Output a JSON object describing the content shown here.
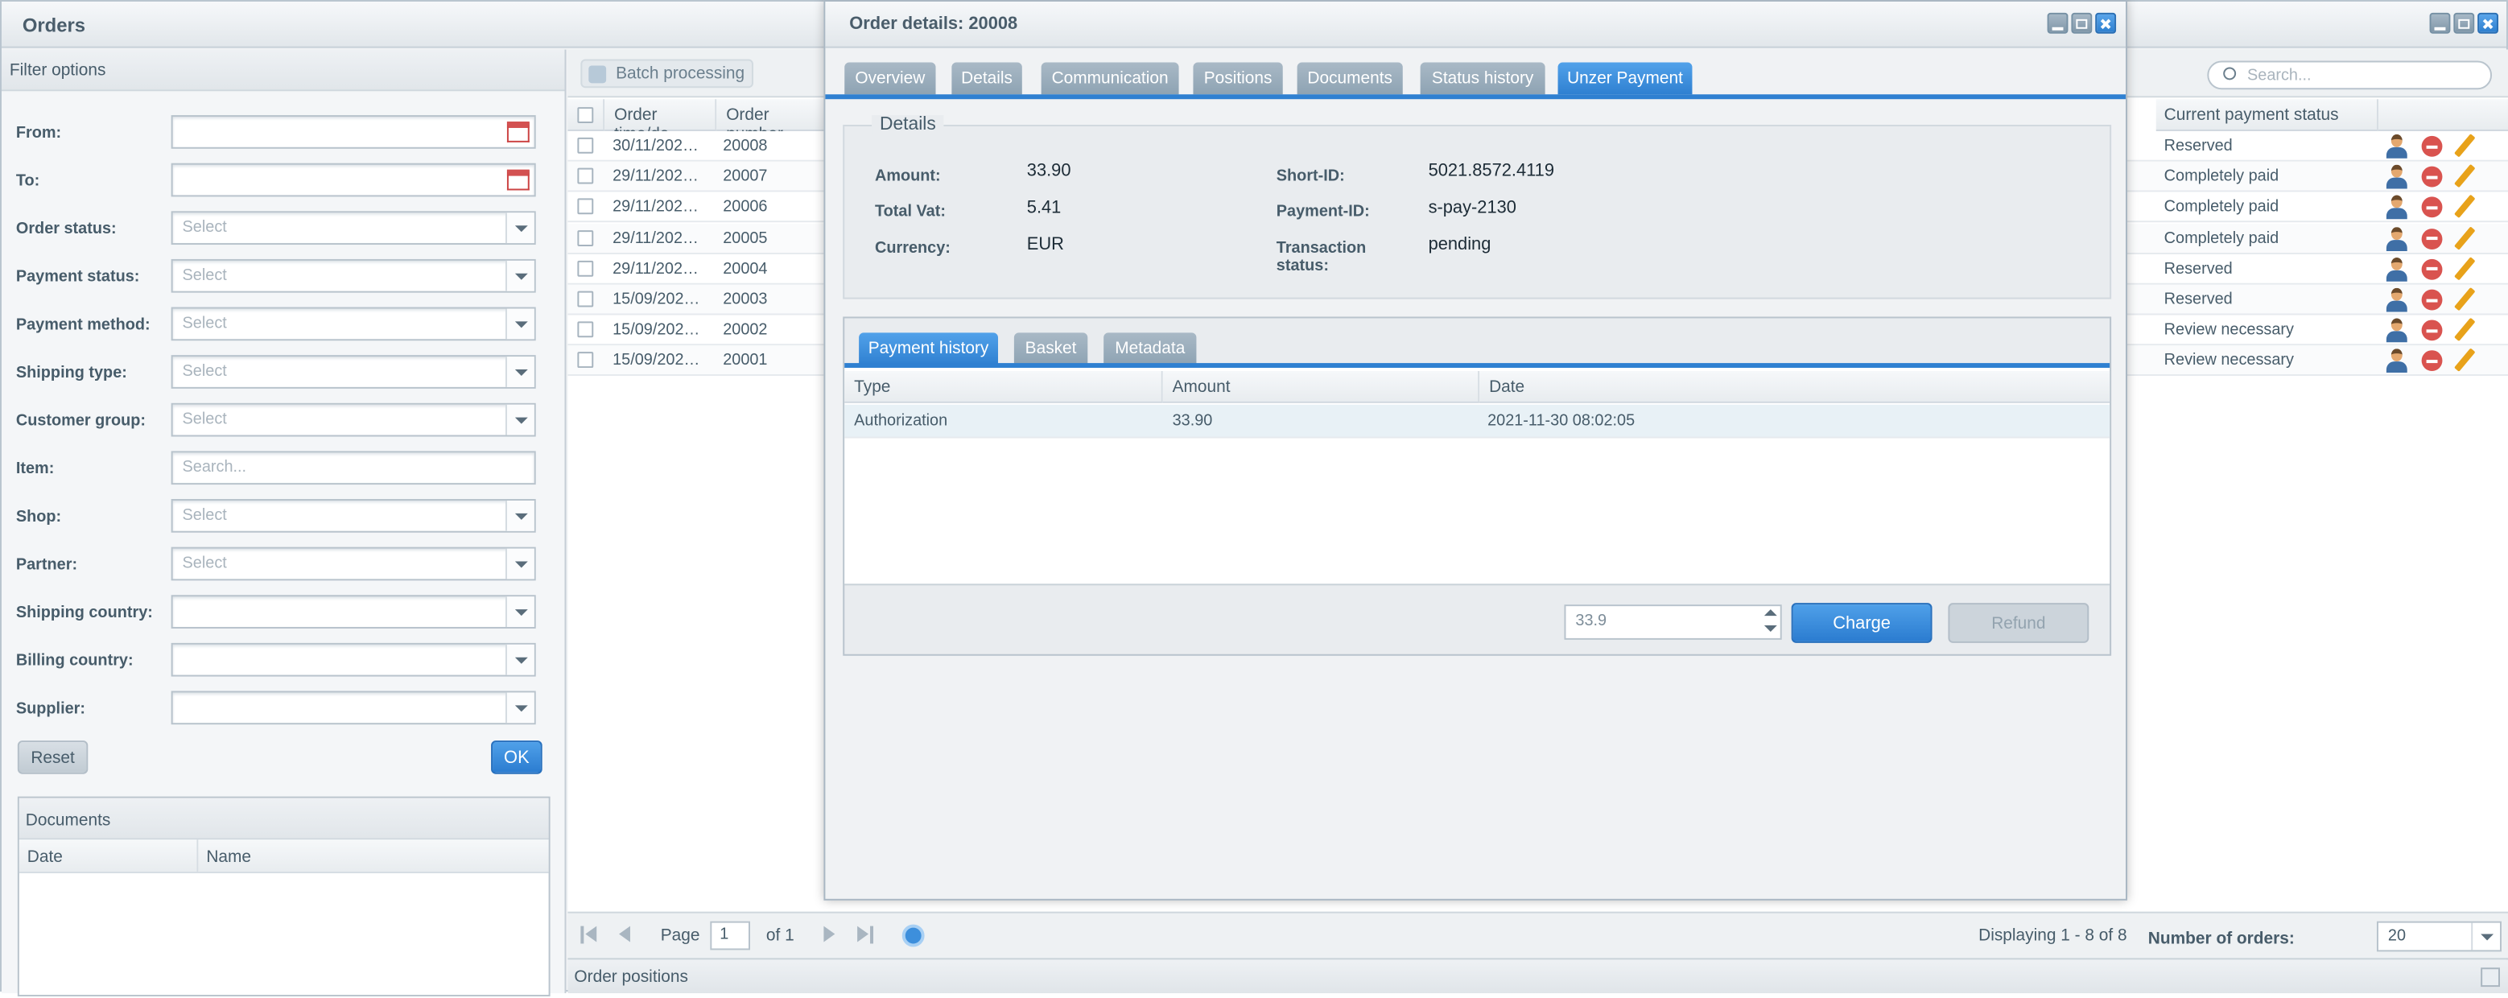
{
  "window": {
    "title": "Orders"
  },
  "filter": {
    "header": "Filter options",
    "fields": [
      {
        "label": "From:",
        "value": "",
        "kind": "date"
      },
      {
        "label": "To:",
        "value": "",
        "kind": "date"
      },
      {
        "label": "Order status:",
        "placeholder": "Select",
        "kind": "select"
      },
      {
        "label": "Payment status:",
        "placeholder": "Select",
        "kind": "select"
      },
      {
        "label": "Payment method:",
        "placeholder": "Select",
        "kind": "select"
      },
      {
        "label": "Shipping type:",
        "placeholder": "Select",
        "kind": "select"
      },
      {
        "label": "Customer group:",
        "placeholder": "Select",
        "kind": "select"
      },
      {
        "label": "Item:",
        "placeholder": "Search...",
        "kind": "text"
      },
      {
        "label": "Shop:",
        "placeholder": "Select",
        "kind": "select"
      },
      {
        "label": "Partner:",
        "placeholder": "Select",
        "kind": "select"
      },
      {
        "label": "Shipping country:",
        "placeholder": "",
        "kind": "select"
      },
      {
        "label": "Billing country:",
        "placeholder": "",
        "kind": "select"
      },
      {
        "label": "Supplier:",
        "placeholder": "",
        "kind": "select"
      }
    ],
    "reset_label": "Reset",
    "ok_label": "OK",
    "documents": {
      "header": "Documents",
      "columns": [
        "Date",
        "Name"
      ]
    }
  },
  "toolbar": {
    "batch_label": "Batch processing",
    "search_placeholder": "Search..."
  },
  "grid": {
    "columns": [
      "Order time/da",
      "Order number",
      "Current payment status"
    ],
    "rows": [
      {
        "time": "30/11/202…",
        "number": "20008",
        "status": "Reserved"
      },
      {
        "time": "29/11/202…",
        "number": "20007",
        "status": "Completely paid"
      },
      {
        "time": "29/11/202…",
        "number": "20006",
        "status": "Completely paid"
      },
      {
        "time": "29/11/202…",
        "number": "20005",
        "status": "Completely paid"
      },
      {
        "time": "29/11/202…",
        "number": "20004",
        "status": "Reserved"
      },
      {
        "time": "15/09/202…",
        "number": "20003",
        "status": "Reserved"
      },
      {
        "time": "15/09/202…",
        "number": "20002",
        "status": "Review necessary"
      },
      {
        "time": "15/09/202…",
        "number": "20001",
        "status": "Review necessary"
      }
    ]
  },
  "pager": {
    "page_label": "Page",
    "page_value": "1",
    "of_label": "of 1",
    "displaying": "Displaying 1 - 8 of 8",
    "count_label": "Number of orders:",
    "count_value": "20"
  },
  "positions_bar": {
    "label": "Order positions"
  },
  "modal": {
    "title": "Order details: 20008",
    "tabs": [
      "Overview",
      "Details",
      "Communication",
      "Positions",
      "Documents",
      "Status history",
      "Unzer Payment"
    ],
    "active_tab": "Unzer Payment",
    "details": {
      "legend": "Details",
      "amount_label": "Amount:",
      "amount": "33.90",
      "vat_label": "Total Vat:",
      "vat": "5.41",
      "currency_label": "Currency:",
      "currency": "EUR",
      "short_id_label": "Short-ID:",
      "short_id": "5021.8572.4119",
      "payment_id_label": "Payment-ID:",
      "payment_id": "s-pay-2130",
      "tx_status_label_1": "Transaction",
      "tx_status_label_2": "status:",
      "tx_status": "pending"
    },
    "sub_tabs": [
      "Payment history",
      "Basket",
      "Metadata"
    ],
    "history": {
      "columns": [
        "Type",
        "Amount",
        "Date"
      ],
      "rows": [
        {
          "type": "Authorization",
          "amount": "33.90",
          "date": "2021-11-30 08:02:05"
        }
      ]
    },
    "charge_value": "33.9",
    "charge_label": "Charge",
    "refund_label": "Refund"
  },
  "colors": {
    "accent": "#2f80d1",
    "tab_inactive": "#8ea3b3"
  }
}
